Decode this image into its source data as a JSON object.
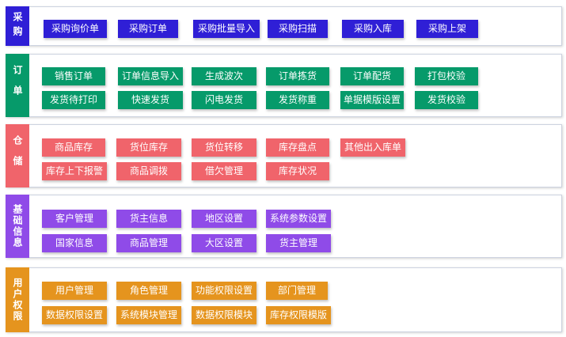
{
  "colors": {
    "purchase": "#2f1fd6",
    "order": "#069a6a",
    "warehouse": "#f0646b",
    "basic": "#8f4be8",
    "user": "#e5941e"
  },
  "sections": {
    "purchase": {
      "label": "采购",
      "buttons": [
        "采购询价单",
        "采购订单",
        "采购批量导入",
        "采购扫描",
        "采购入库",
        "采购上架"
      ]
    },
    "order": {
      "label": "订单",
      "buttons": [
        "销售订单",
        "订单信息导入",
        "生成波次",
        "订单拣货",
        "订单配货",
        "打包校验",
        "发货待打印",
        "快速发货",
        "闪电发货",
        "发货称重",
        "单据模版设置",
        "发货校验"
      ]
    },
    "warehouse": {
      "label": "仓储",
      "buttons": [
        "商品库存",
        "货位库存",
        "货位转移",
        "库存盘点",
        "其他出入库单",
        "库存上下报警",
        "商品调拨",
        "借欠管理",
        "库存状况"
      ]
    },
    "basic": {
      "label": "基础信息",
      "buttons": [
        "客户管理",
        "货主信息",
        "地区设置",
        "系统参数设置",
        "国家信息",
        "商品管理",
        "大区设置",
        "货主管理"
      ]
    },
    "user": {
      "label": "用户权限",
      "buttons": [
        "用户管理",
        "角色管理",
        "功能权限设置",
        "部门管理",
        "数据权限设置",
        "系统模块管理",
        "数据权限模块",
        "库存权限模版"
      ]
    }
  }
}
